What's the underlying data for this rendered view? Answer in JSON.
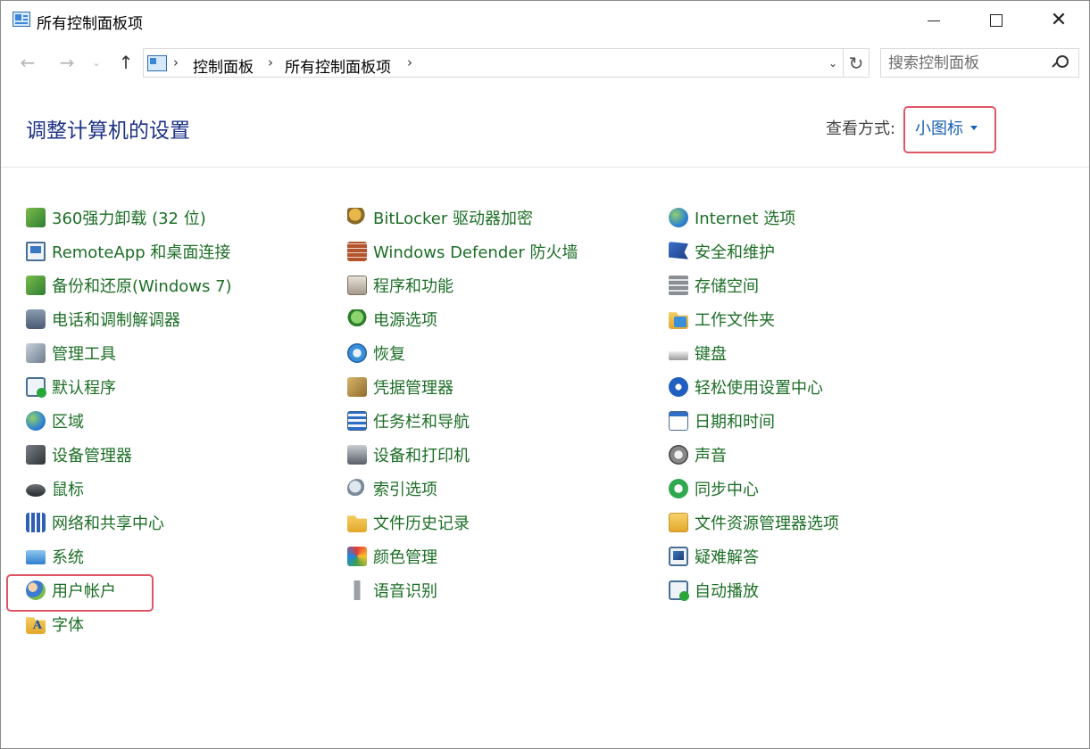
{
  "window": {
    "title": "所有控制面板项",
    "minimize_glyph": "",
    "close_glyph": "✕"
  },
  "nav": {
    "back_glyph": "←",
    "forward_glyph": "→",
    "recent_glyph": "⌄",
    "up_glyph": "↑",
    "breadcrumbs": [
      "控制面板",
      "所有控制面板项"
    ],
    "separator": "›",
    "dropdown_glyph": "⌄",
    "refresh_glyph": "↻",
    "search_placeholder": "搜索控制面板"
  },
  "header": {
    "title": "调整计算机的设置",
    "view_by_label": "查看方式:",
    "view_by_value": "小图标"
  },
  "columns": [
    [
      {
        "label": "360强力卸载 (32 位)",
        "icon": "uninstall-icon"
      },
      {
        "label": "RemoteApp 和桌面连接",
        "icon": "remote-desktop-icon"
      },
      {
        "label": "备份和还原(Windows 7)",
        "icon": "backup-icon"
      },
      {
        "label": "电话和调制解调器",
        "icon": "phone-modem-icon"
      },
      {
        "label": "管理工具",
        "icon": "admin-tools-icon"
      },
      {
        "label": "默认程序",
        "icon": "default-programs-icon"
      },
      {
        "label": "区域",
        "icon": "region-icon"
      },
      {
        "label": "设备管理器",
        "icon": "device-manager-icon"
      },
      {
        "label": "鼠标",
        "icon": "mouse-icon"
      },
      {
        "label": "网络和共享中心",
        "icon": "network-icon"
      },
      {
        "label": "系统",
        "icon": "system-icon"
      },
      {
        "label": "用户帐户",
        "icon": "user-accounts-icon"
      },
      {
        "label": "字体",
        "icon": "fonts-icon"
      }
    ],
    [
      {
        "label": "BitLocker 驱动器加密",
        "icon": "bitlocker-icon"
      },
      {
        "label": "Windows Defender 防火墙",
        "icon": "firewall-icon"
      },
      {
        "label": "程序和功能",
        "icon": "programs-icon"
      },
      {
        "label": "电源选项",
        "icon": "power-icon"
      },
      {
        "label": "恢复",
        "icon": "recovery-icon"
      },
      {
        "label": "凭据管理器",
        "icon": "credential-icon"
      },
      {
        "label": "任务栏和导航",
        "icon": "taskbar-icon"
      },
      {
        "label": "设备和打印机",
        "icon": "printer-icon"
      },
      {
        "label": "索引选项",
        "icon": "indexing-icon"
      },
      {
        "label": "文件历史记录",
        "icon": "file-history-icon"
      },
      {
        "label": "颜色管理",
        "icon": "color-management-icon"
      },
      {
        "label": "语音识别",
        "icon": "microphone-icon"
      }
    ],
    [
      {
        "label": "Internet 选项",
        "icon": "internet-options-icon"
      },
      {
        "label": "安全和维护",
        "icon": "security-flag-icon"
      },
      {
        "label": "存储空间",
        "icon": "storage-icon"
      },
      {
        "label": "工作文件夹",
        "icon": "work-folders-icon"
      },
      {
        "label": "键盘",
        "icon": "keyboard-icon"
      },
      {
        "label": "轻松使用设置中心",
        "icon": "ease-of-access-icon"
      },
      {
        "label": "日期和时间",
        "icon": "calendar-icon"
      },
      {
        "label": "声音",
        "icon": "speaker-icon"
      },
      {
        "label": "同步中心",
        "icon": "sync-icon"
      },
      {
        "label": "文件资源管理器选项",
        "icon": "folder-options-icon"
      },
      {
        "label": "疑难解答",
        "icon": "troubleshoot-icon"
      },
      {
        "label": "自动播放",
        "icon": "autoplay-icon"
      }
    ]
  ]
}
